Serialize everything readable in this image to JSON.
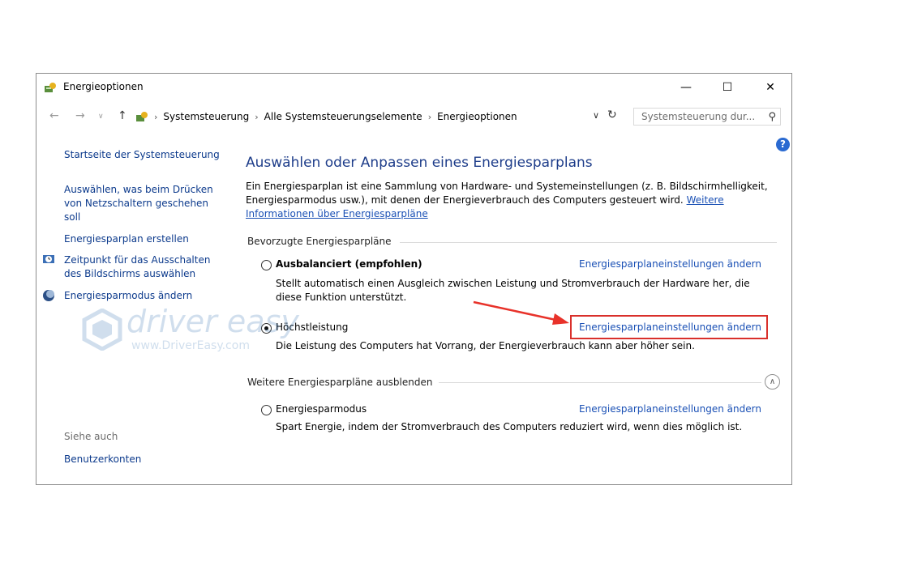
{
  "window": {
    "title": "Energieoptionen",
    "controls": {
      "minimize": "—",
      "maximize": "☐",
      "close": "✕"
    }
  },
  "address_bar": {
    "breadcrumb": [
      "Systemsteuerung",
      "Alle Systemsteuerungselemente",
      "Energieoptionen"
    ],
    "search_placeholder": "Systemsteuerung dur..."
  },
  "sidebar": {
    "home": "Startseite der Systemsteuerung",
    "links": [
      "Auswählen, was beim Drücken von Netzschaltern geschehen soll",
      "Energiesparplan erstellen",
      "Zeitpunkt für das Ausschalten des Bildschirms auswählen",
      "Energiesparmodus ändern"
    ],
    "see_also_heading": "Siehe auch",
    "see_also_links": [
      "Benutzerkonten"
    ]
  },
  "main": {
    "title": "Auswählen oder Anpassen eines Energiesparplans",
    "description": "Ein Energiesparplan ist eine Sammlung von Hardware- und Systemeinstellungen (z. B. Bildschirmhelligkeit, Energiesparmodus usw.), mit denen der Energieverbrauch des Computers gesteuert wird.",
    "more_info_link": "Weitere Informationen über Energiesparpläne",
    "preferred_heading": "Bevorzugte Energiesparpläne",
    "hidden_heading": "Weitere Energiesparpläne ausblenden",
    "plans": [
      {
        "name": "Ausbalanciert (empfohlen)",
        "selected": false,
        "description": "Stellt automatisch einen Ausgleich zwischen Leistung und Stromverbrauch der Hardware her, die diese Funktion unterstützt.",
        "link": "Energiesparplaneinstellungen ändern"
      },
      {
        "name": "Höchstleistung",
        "selected": true,
        "description": "Die Leistung des Computers hat Vorrang, der Energieverbrauch kann aber höher sein.",
        "link": "Energiesparplaneinstellungen ändern"
      },
      {
        "name": "Energiesparmodus",
        "selected": false,
        "description": "Spart Energie, indem der Stromverbrauch des Computers reduziert wird, wenn dies möglich ist.",
        "link": "Energiesparplaneinstellungen ändern"
      }
    ]
  },
  "watermark": {
    "brand": "driver easy",
    "url": "www.DriverEasy.com"
  },
  "colors": {
    "link": "#1a50b5",
    "title": "#1e3d8a",
    "highlight": "#d9302b",
    "arrow": "#e8322a"
  }
}
